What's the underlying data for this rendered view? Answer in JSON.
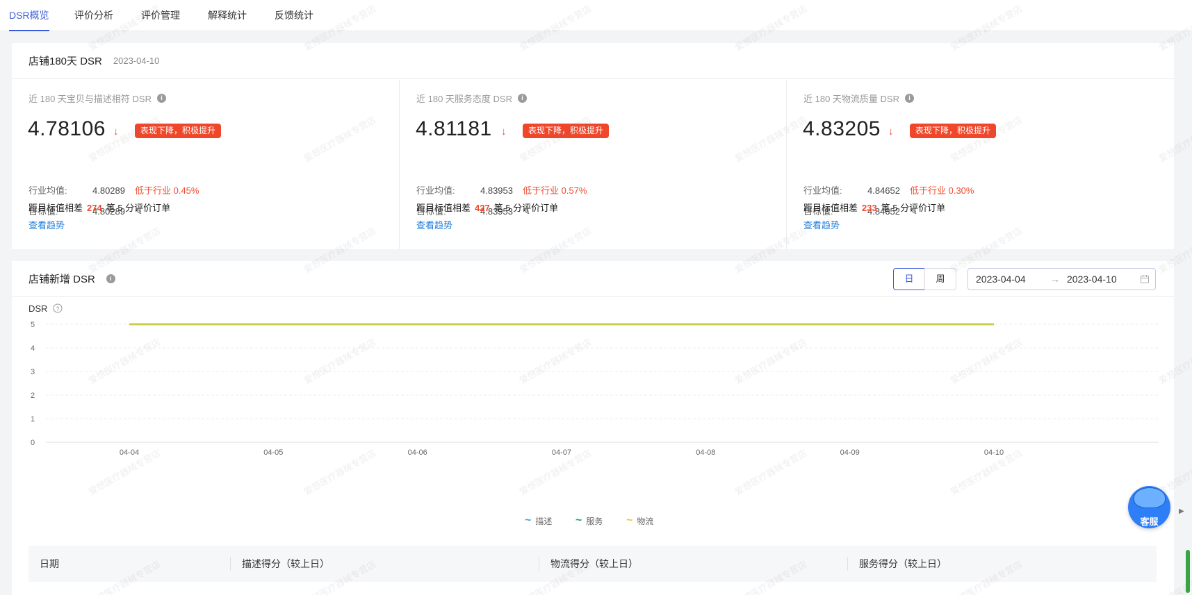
{
  "nav": {
    "tabs": [
      {
        "label": "DSR概览",
        "active": true
      },
      {
        "label": "评价分析"
      },
      {
        "label": "评价管理"
      },
      {
        "label": "解释统计"
      },
      {
        "label": "反馈统计"
      }
    ]
  },
  "summary": {
    "title": "店铺180天 DSR",
    "date": "2023-04-10",
    "metrics": [
      {
        "title": "近 180 天宝贝与描述相符 DSR",
        "value": "4.78106",
        "badge": "表现下降，积极提升",
        "industry_label": "行业均值:",
        "industry_value": "4.80289",
        "diff": "低于行业 0.45%",
        "target_label": "目标值:",
        "target_value": "4.80289",
        "gap_prefix": "距目标值相差",
        "gap_count": "274",
        "gap_suffix": "笔 5 分评价订单",
        "trend_link": "查看趋势"
      },
      {
        "title": "近 180 天服务态度 DSR",
        "value": "4.81181",
        "badge": "表现下降，积极提升",
        "industry_label": "行业均值:",
        "industry_value": "4.83953",
        "diff": "低于行业 0.57%",
        "target_label": "目标值:",
        "target_value": "4.83953",
        "gap_prefix": "距目标值相差",
        "gap_count": "427",
        "gap_suffix": "笔 5 分评价订单",
        "trend_link": "查看趋势"
      },
      {
        "title": "近 180 天物流质量 DSR",
        "value": "4.83205",
        "badge": "表现下降，积极提升",
        "industry_label": "行业均值:",
        "industry_value": "4.84652",
        "diff": "低于行业 0.30%",
        "target_label": "目标值:",
        "target_value": "4.84652",
        "gap_prefix": "距目标值相差",
        "gap_count": "233",
        "gap_suffix": "笔 5 分评价订单",
        "trend_link": "查看趋势"
      }
    ]
  },
  "daily": {
    "title": "店铺新增 DSR",
    "toggle_day": "日",
    "toggle_week": "周",
    "range_start": "2023-04-04",
    "range_arrow": "→",
    "range_end": "2023-04-10"
  },
  "chart_data": {
    "type": "line",
    "ylabel": "DSR",
    "x": [
      "04-04",
      "04-05",
      "04-06",
      "04-07",
      "04-08",
      "04-09",
      "04-10"
    ],
    "yticks": [
      "0",
      "1",
      "2",
      "3",
      "4",
      "5"
    ],
    "ylim": [
      0,
      5
    ],
    "grid": true,
    "legend": "bottom-center",
    "series": [
      {
        "name": "描述",
        "color": "#36a3f7",
        "values": [
          5,
          5,
          5,
          5,
          5,
          5,
          5
        ]
      },
      {
        "name": "服务",
        "color": "#1aa56a",
        "values": [
          5,
          5,
          5,
          5,
          5,
          5,
          5
        ]
      },
      {
        "name": "物流",
        "color": "#f6c02b",
        "values": [
          5,
          5,
          5,
          5,
          5,
          5,
          5
        ]
      }
    ]
  },
  "table": {
    "headers": [
      "日期",
      "描述得分（较上日）",
      "物流得分（较上日）",
      "服务得分（较上日）"
    ]
  },
  "watermark": "爱想医疗器械专营店",
  "customer_service": {
    "label": "客服"
  },
  "colors": {
    "accent": "#3a5bd9",
    "alert": "#f04a2d",
    "link": "#1e7bd8"
  }
}
